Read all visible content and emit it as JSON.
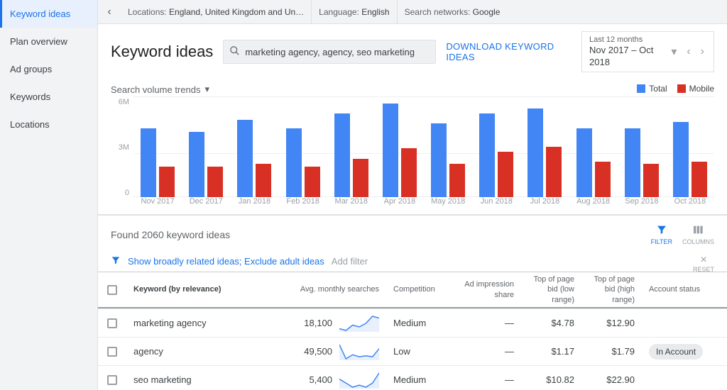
{
  "sidebar": {
    "items": [
      {
        "label": "Keyword ideas",
        "active": true
      },
      {
        "label": "Plan overview"
      },
      {
        "label": "Ad groups"
      },
      {
        "label": "Keywords"
      },
      {
        "label": "Locations"
      }
    ]
  },
  "topbar": {
    "locations_lbl": "Locations:",
    "locations_val": "England, United Kingdom and Un…",
    "language_lbl": "Language:",
    "language_val": "English",
    "networks_lbl": "Search networks:",
    "networks_val": "Google"
  },
  "header": {
    "title": "Keyword ideas",
    "search_value": "marketing agency, agency, seo marketing",
    "download_label": "DOWNLOAD KEYWORD IDEAS",
    "date_range_label": "Last 12 months",
    "date_range_value": "Nov 2017 – Oct 2018"
  },
  "chart_meta": {
    "trends_label": "Search volume trends",
    "legend_total": "Total",
    "legend_mobile": "Mobile",
    "color_total": "#4285F4",
    "color_mobile": "#d93025",
    "y_ticks": [
      "6M",
      "3M",
      "0"
    ]
  },
  "chart_data": {
    "type": "bar",
    "categories": [
      "Nov 2017",
      "Dec 2017",
      "Jan 2018",
      "Feb 2018",
      "Mar 2018",
      "Apr 2018",
      "May 2018",
      "Jun 2018",
      "Jul 2018",
      "Aug 2018",
      "Sep 2018",
      "Oct 2018"
    ],
    "series": [
      {
        "name": "Total",
        "values": [
          4.1,
          3.9,
          4.6,
          4.1,
          5.0,
          5.6,
          4.4,
          5.0,
          5.3,
          4.1,
          4.1,
          4.5
        ]
      },
      {
        "name": "Mobile",
        "values": [
          1.8,
          1.8,
          2.0,
          1.8,
          2.3,
          2.9,
          2.0,
          2.7,
          3.0,
          2.1,
          2.0,
          2.1
        ]
      }
    ],
    "ylabel": "",
    "ylim": [
      0,
      6
    ]
  },
  "results": {
    "found_text": "Found 2060 keyword ideas",
    "filter_label": "FILTER",
    "columns_label": "COLUMNS",
    "chip_text": "Show broadly related ideas; Exclude adult ideas",
    "add_filter": "Add filter",
    "reset": "RESET"
  },
  "table": {
    "headers": {
      "keyword": "Keyword (by relevance)",
      "ams": "Avg. monthly searches",
      "competition": "Competition",
      "impression": "Ad impression share",
      "bid_low": "Top of page bid (low range)",
      "bid_high": "Top of page bid (high range)",
      "account": "Account status"
    },
    "rows": [
      {
        "keyword": "marketing agency",
        "ams": "18,100",
        "competition": "Medium",
        "impression": "—",
        "bid_low": "$4.78",
        "bid_high": "$12.90",
        "account": "",
        "spark": [
          8,
          6,
          12,
          10,
          14,
          22,
          20
        ]
      },
      {
        "keyword": "agency",
        "ams": "49,500",
        "competition": "Low",
        "impression": "—",
        "bid_low": "$1.17",
        "bid_high": "$1.79",
        "account": "In Account",
        "spark": [
          20,
          6,
          10,
          8,
          9,
          8,
          16
        ]
      },
      {
        "keyword": "seo marketing",
        "ams": "5,400",
        "competition": "Medium",
        "impression": "—",
        "bid_low": "$10.82",
        "bid_high": "$22.90",
        "account": "",
        "spark": [
          14,
          10,
          6,
          8,
          6,
          10,
          20
        ]
      }
    ]
  }
}
